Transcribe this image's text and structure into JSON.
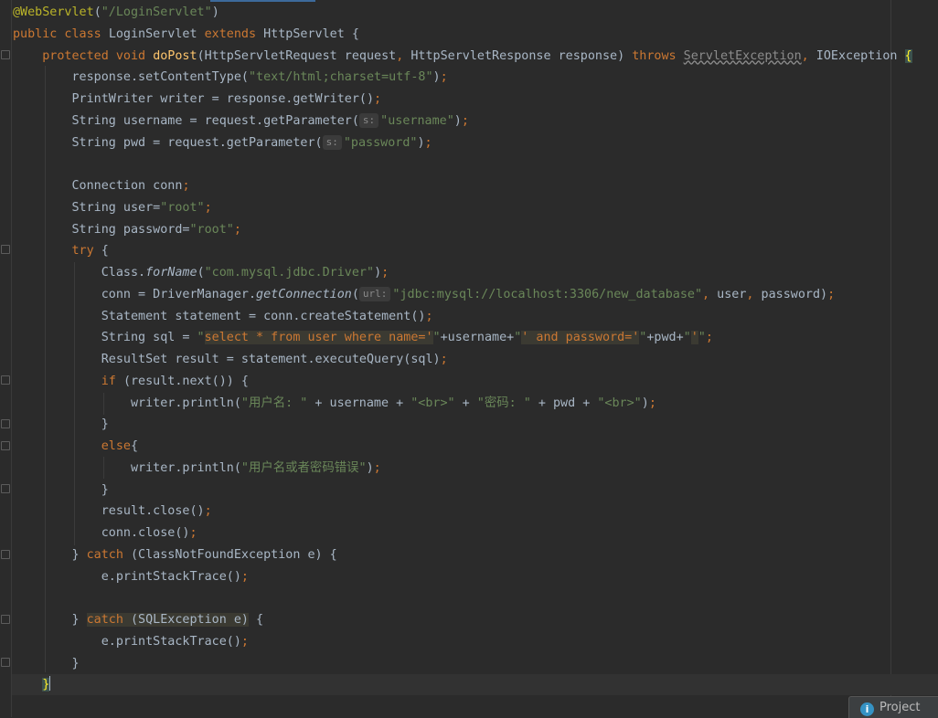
{
  "editor": {
    "lines": [
      [
        [
          "ann",
          "@WebServlet"
        ],
        [
          "pl",
          "("
        ],
        [
          "str",
          "\"/LoginServlet\""
        ],
        [
          "pl",
          ")"
        ]
      ],
      [
        [
          "kw",
          "public class "
        ],
        [
          "pl",
          "LoginServlet "
        ],
        [
          "kw",
          "extends "
        ],
        [
          "pl",
          "HttpServlet {"
        ]
      ],
      [
        [
          "pl",
          "    "
        ],
        [
          "kw",
          "protected void "
        ],
        [
          "fn",
          "doPost"
        ],
        [
          "pl",
          "(HttpServletRequest request"
        ],
        [
          "kw",
          ", "
        ],
        [
          "pl",
          "HttpServletResponse response) "
        ],
        [
          "kw",
          "throws "
        ],
        [
          "warn",
          "ServletException"
        ],
        [
          "kw",
          ", "
        ],
        [
          "pl",
          "IOException "
        ],
        [
          "brace",
          "{"
        ]
      ],
      [
        [
          "pl",
          "        response.setContentType("
        ],
        [
          "str",
          "\"text/html;charset=utf-8\""
        ],
        [
          "pl",
          ")"
        ],
        [
          "kw",
          ";"
        ]
      ],
      [
        [
          "pl",
          "        PrintWriter writer = response.getWriter()"
        ],
        [
          "kw",
          ";"
        ]
      ],
      [
        [
          "pl",
          "        String username = request.getParameter("
        ],
        [
          "hint",
          "s:"
        ],
        [
          "str",
          "\"username\""
        ],
        [
          "pl",
          ")"
        ],
        [
          "kw",
          ";"
        ]
      ],
      [
        [
          "pl",
          "        String pwd = request.getParameter("
        ],
        [
          "hint",
          "s:"
        ],
        [
          "str",
          "\"password\""
        ],
        [
          "pl",
          ")"
        ],
        [
          "kw",
          ";"
        ]
      ],
      [],
      [
        [
          "pl",
          "        Connection conn"
        ],
        [
          "kw",
          ";"
        ]
      ],
      [
        [
          "pl",
          "        String user="
        ],
        [
          "str",
          "\"root\""
        ],
        [
          "kw",
          ";"
        ]
      ],
      [
        [
          "pl",
          "        String password="
        ],
        [
          "str",
          "\"root\""
        ],
        [
          "kw",
          ";"
        ]
      ],
      [
        [
          "pl",
          "        "
        ],
        [
          "kw",
          "try "
        ],
        [
          "pl",
          "{"
        ]
      ],
      [
        [
          "pl",
          "            Class."
        ],
        [
          "ital",
          "forName"
        ],
        [
          "pl",
          "("
        ],
        [
          "str",
          "\"com.mysql.jdbc.Driver\""
        ],
        [
          "pl",
          ")"
        ],
        [
          "kw",
          ";"
        ]
      ],
      [
        [
          "pl",
          "            conn = DriverManager."
        ],
        [
          "ital",
          "getConnection"
        ],
        [
          "pl",
          "("
        ],
        [
          "hint",
          "url:"
        ],
        [
          "str",
          "\"jdbc:mysql://localhost:3306/new_database\""
        ],
        [
          "kw",
          ", "
        ],
        [
          "pl",
          "user"
        ],
        [
          "kw",
          ", "
        ],
        [
          "pl",
          "password)"
        ],
        [
          "kw",
          ";"
        ]
      ],
      [
        [
          "pl",
          "            Statement statement = conn.createStatement()"
        ],
        [
          "kw",
          ";"
        ]
      ],
      [
        [
          "pl",
          "            String sql = "
        ],
        [
          "str",
          "\""
        ],
        [
          "hlk",
          "select * from user where name='"
        ],
        [
          "str",
          "\""
        ],
        [
          "pl",
          "+username+"
        ],
        [
          "str",
          "\""
        ],
        [
          "hlk",
          "' and password='"
        ],
        [
          "str",
          "\""
        ],
        [
          "pl",
          "+pwd+"
        ],
        [
          "str",
          "\""
        ],
        [
          "hlk",
          "'"
        ],
        [
          "str",
          "\""
        ],
        [
          "kw",
          ";"
        ]
      ],
      [
        [
          "pl",
          "            ResultSet result = statement.executeQuery(sql)"
        ],
        [
          "kw",
          ";"
        ]
      ],
      [
        [
          "pl",
          "            "
        ],
        [
          "kw",
          "if "
        ],
        [
          "pl",
          "(result.next()) {"
        ]
      ],
      [
        [
          "pl",
          "                writer.println("
        ],
        [
          "str",
          "\"用户名: \""
        ],
        [
          "pl",
          " + username + "
        ],
        [
          "str",
          "\"<br>\""
        ],
        [
          "pl",
          " + "
        ],
        [
          "str",
          "\"密码: \""
        ],
        [
          "pl",
          " + pwd + "
        ],
        [
          "str",
          "\"<br>\""
        ],
        [
          "pl",
          ")"
        ],
        [
          "kw",
          ";"
        ]
      ],
      [
        [
          "pl",
          "            }"
        ]
      ],
      [
        [
          "pl",
          "            "
        ],
        [
          "kw",
          "else"
        ],
        [
          "pl",
          "{"
        ]
      ],
      [
        [
          "pl",
          "                writer.println("
        ],
        [
          "str",
          "\"用户名或者密码错误\""
        ],
        [
          "pl",
          ")"
        ],
        [
          "kw",
          ";"
        ]
      ],
      [
        [
          "pl",
          "            }"
        ]
      ],
      [
        [
          "pl",
          "            result.close()"
        ],
        [
          "kw",
          ";"
        ]
      ],
      [
        [
          "pl",
          "            conn.close()"
        ],
        [
          "kw",
          ";"
        ]
      ],
      [
        [
          "pl",
          "        } "
        ],
        [
          "kw",
          "catch "
        ],
        [
          "pl",
          "(ClassNotFoundException e) {"
        ]
      ],
      [
        [
          "pl",
          "            e.printStackTrace()"
        ],
        [
          "kw",
          ";"
        ]
      ],
      [],
      [
        [
          "pl",
          "        } "
        ],
        [
          "hlk2",
          "catch "
        ],
        [
          "hlp",
          "(SQLException e)"
        ],
        [
          "pl",
          " {"
        ]
      ],
      [
        [
          "pl",
          "            e.printStackTrace()"
        ],
        [
          "kw",
          ";"
        ]
      ],
      [
        [
          "pl",
          "        }"
        ]
      ],
      [
        [
          "pl",
          "    "
        ],
        [
          "brace",
          "}"
        ],
        [
          "caret",
          ""
        ]
      ]
    ]
  },
  "tool_window_tab": {
    "icon": "info-icon",
    "label": "Project"
  },
  "colors": {
    "background": "#2b2b2b",
    "keyword": "#cc7832",
    "string": "#6a8759",
    "annotation": "#bbb529",
    "method": "#ffc66d",
    "text": "#a9b7c6"
  }
}
